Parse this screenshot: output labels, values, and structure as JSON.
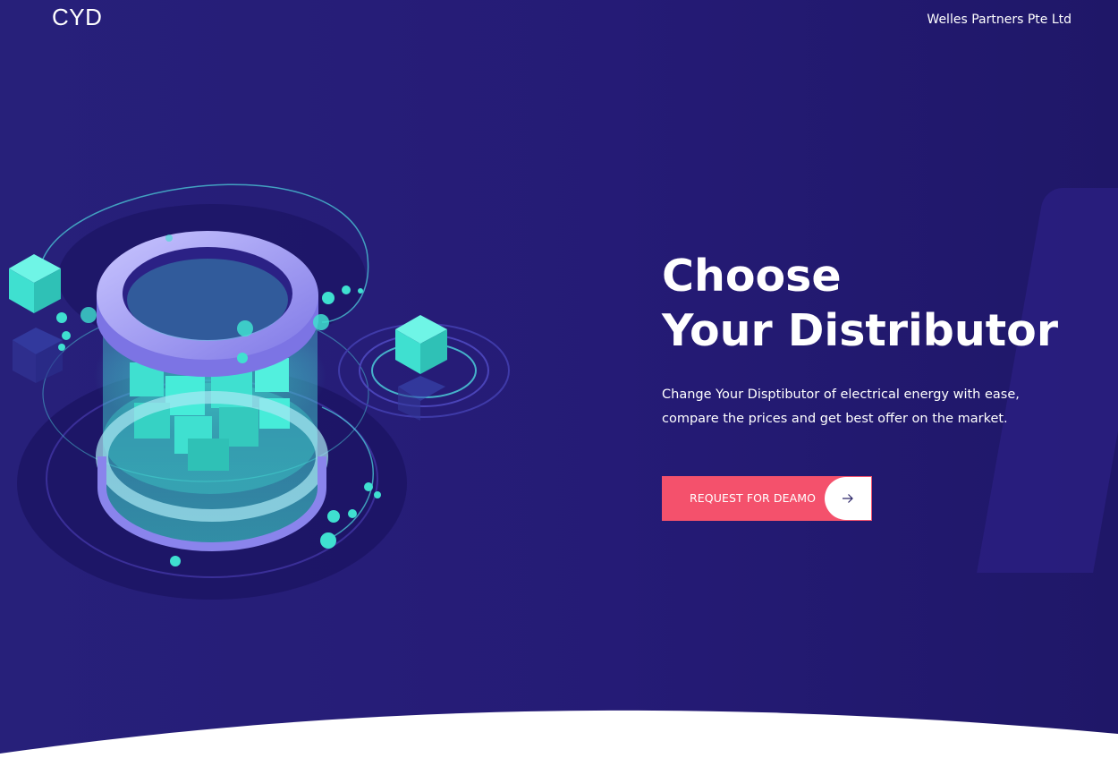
{
  "header": {
    "brand": "CYD",
    "company": "Welles Partners Pte Ltd"
  },
  "hero": {
    "title_line1": "Choose",
    "title_line2": "Your Distributor",
    "description": "Change Your Disptibutor of electrical energy with ease, compare the prices and get best offer on the market.",
    "cta_label": "REQUEST FOR DEAMO",
    "cta_icon": "arrow-right-icon",
    "illustration": "isometric-data-cylinder-with-cubes"
  },
  "colors": {
    "background": "#251b76",
    "accent": "#f4516c",
    "cyan": "#3fe0d0",
    "ring": "#a7a3f0",
    "text": "#ffffff"
  }
}
